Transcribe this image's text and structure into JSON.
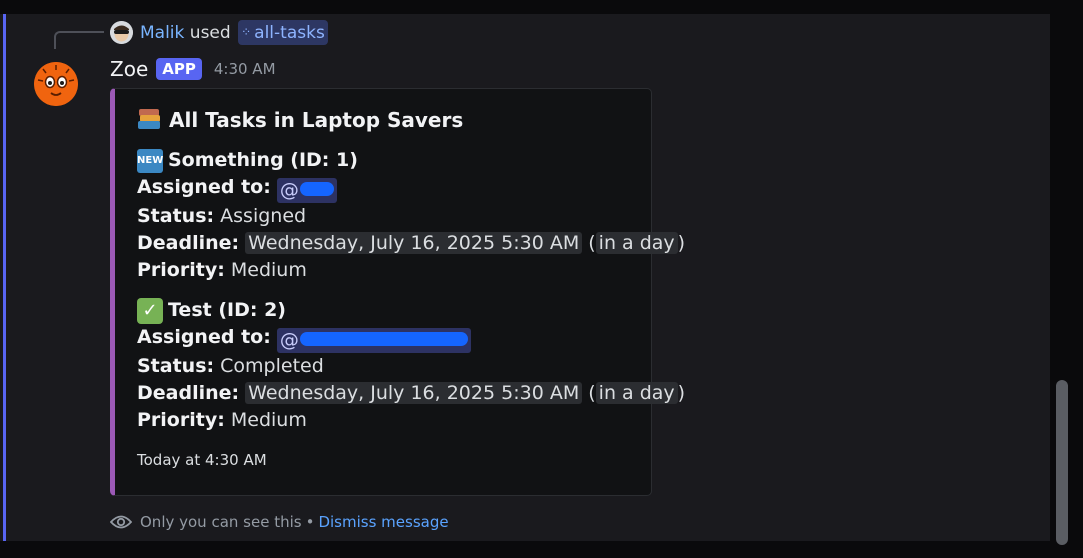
{
  "reply": {
    "user": "Malik",
    "used_text": "used",
    "command": "all-tasks"
  },
  "message": {
    "author": "Zoe",
    "badge": "APP",
    "timestamp": "4:30 AM"
  },
  "embed": {
    "title": "All Tasks in Laptop Savers",
    "accent_color": "#9b59b6",
    "tasks": [
      {
        "icon": "new-icon",
        "icon_text": "NEW",
        "heading": "Something (ID: 1)",
        "assigned_label": "Assigned to:",
        "assigned_value": "@",
        "status_label": "Status:",
        "status_value": "Assigned",
        "deadline_label": "Deadline:",
        "deadline_value": "Wednesday, July 16, 2025 5:30 AM",
        "deadline_relative": "in a day",
        "priority_label": "Priority:",
        "priority_value": "Medium"
      },
      {
        "icon": "check-icon",
        "icon_text": "✓",
        "heading": "Test (ID: 2)",
        "assigned_label": "Assigned to:",
        "assigned_value": "@",
        "status_label": "Status:",
        "status_value": "Completed",
        "deadline_label": "Deadline:",
        "deadline_value": "Wednesday, July 16, 2025 5:30 AM",
        "deadline_relative": "in a day",
        "priority_label": "Priority:",
        "priority_value": "Medium"
      }
    ],
    "footer": "Today at 4:30 AM"
  },
  "ephemeral": {
    "notice": "Only you can see this",
    "separator": "•",
    "dismiss": "Dismiss message"
  },
  "colors": {
    "accent": "#5865f2",
    "link": "#5aa3ff"
  }
}
